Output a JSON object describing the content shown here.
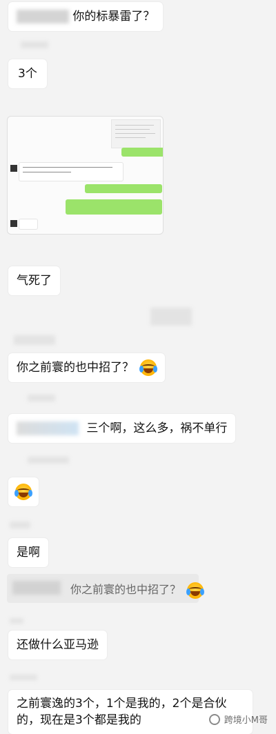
{
  "messages": [
    {
      "text": "你的标暴雷了？"
    },
    {
      "text": "3个"
    },
    {
      "text": "气死了"
    },
    {
      "text": "你之前寰的也中招了？"
    },
    {
      "text": "三个啊，这么多，祸不单行"
    },
    {
      "text": "是啊"
    },
    {
      "text": "还做什么亚马逊"
    },
    {
      "line1": "之前寰逸的3个，1个是我的，2个是合伙",
      "line2": "的，现在是3个都是我的"
    }
  ],
  "quote": {
    "text": "你之前寰的也中招了？"
  },
  "watermark": {
    "text": "跨境小M哥"
  },
  "colors": {
    "background": "#f3f3f3",
    "bubble_white": "#ffffff",
    "bubble_green": "#9be36a"
  }
}
